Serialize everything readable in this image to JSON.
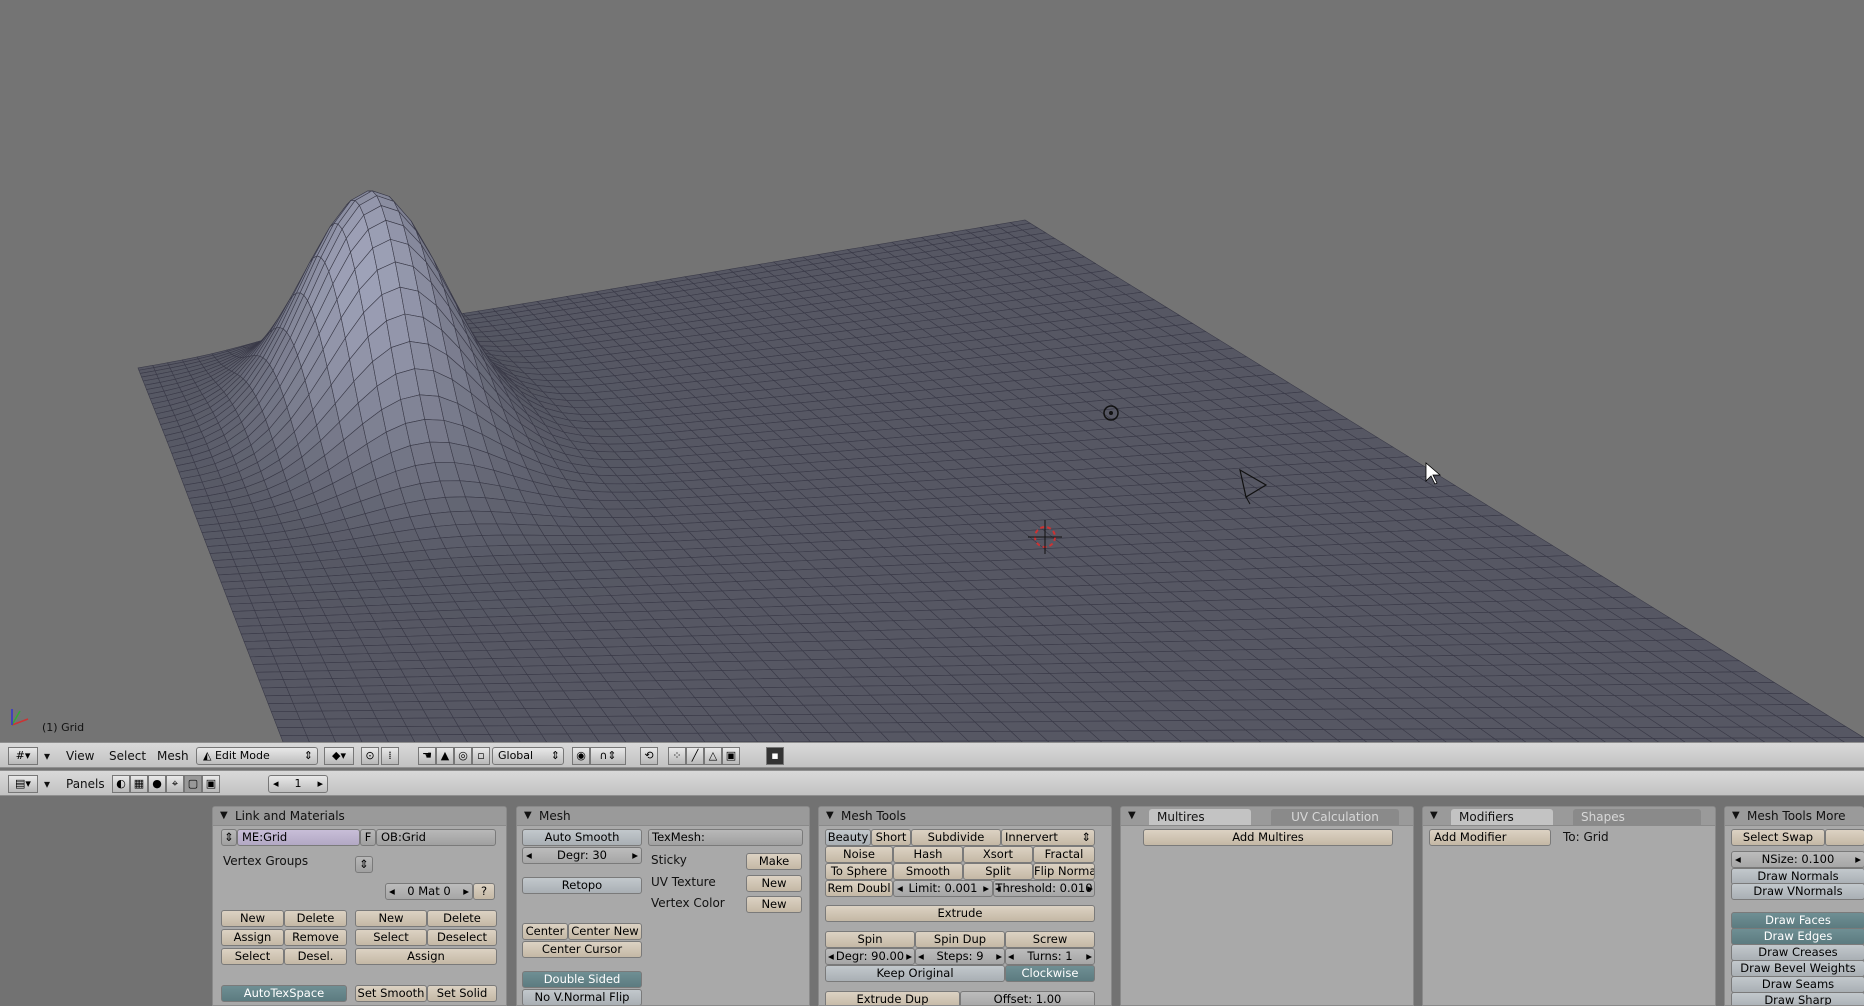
{
  "viewport": {
    "object_label": "(1) Grid"
  },
  "header3d": {
    "menus": [
      "View",
      "Select",
      "Mesh"
    ],
    "mode": "Edit Mode",
    "orientation": "Global"
  },
  "header_buttons": {
    "panels_label": "Panels",
    "frame": "1"
  },
  "link_materials": {
    "title": "Link and Materials",
    "me_field": "ME:Grid",
    "f_label": "F",
    "ob_field": "OB:Grid",
    "vertex_groups": "Vertex Groups",
    "mat_field": "0 Mat 0",
    "help": "?",
    "vg_new": "New",
    "vg_delete": "Delete",
    "vg_assign": "Assign",
    "vg_remove": "Remove",
    "vg_select": "Select",
    "vg_desel": "Desel.",
    "mat_new": "New",
    "mat_delete": "Delete",
    "mat_select": "Select",
    "mat_deselect": "Deselect",
    "mat_assign": "Assign",
    "autotexspace": "AutoTexSpace",
    "set_smooth": "Set Smooth",
    "set_solid": "Set Solid"
  },
  "mesh": {
    "title": "Mesh",
    "auto_smooth": "Auto Smooth",
    "degr": "Degr: 30",
    "retopo": "Retopo",
    "center": "Center",
    "center_new": "Center New",
    "center_cursor": "Center Cursor",
    "double_sided": "Double Sided",
    "no_v_normal_flip": "No V.Normal Flip",
    "texmesh": "TexMesh:",
    "sticky": "Sticky",
    "make": "Make",
    "uv_texture": "UV Texture",
    "uv_new": "New",
    "vertex_color": "Vertex Color",
    "vc_new": "New"
  },
  "mesh_tools": {
    "title": "Mesh Tools",
    "beauty": "Beauty",
    "short": "Short",
    "subdivide": "Subdivide",
    "innervert": "Innervert",
    "noise": "Noise",
    "hash": "Hash",
    "xsort": "Xsort",
    "fractal": "Fractal",
    "to_sphere": "To Sphere",
    "smooth": "Smooth",
    "split": "Split",
    "flip_normals": "Flip Normals",
    "rem_doubl": "Rem Doubl",
    "limit": "Limit: 0.001",
    "threshold": "Threshold: 0.010",
    "extrude": "Extrude",
    "spin": "Spin",
    "spin_dup": "Spin Dup",
    "screw": "Screw",
    "degr": "Degr: 90.00",
    "steps": "Steps: 9",
    "turns": "Turns: 1",
    "keep_original": "Keep Original",
    "clockwise": "Clockwise",
    "extrude_dup": "Extrude Dup",
    "offset": "Offset: 1.00"
  },
  "multires": {
    "tab1": "Multires",
    "tab2": "UV Calculation",
    "add_multires": "Add Multires"
  },
  "modifiers": {
    "tab1": "Modifiers",
    "tab2": "Shapes",
    "add_modifier": "Add Modifier",
    "to": "To: Grid"
  },
  "mesh_tools_more": {
    "title": "Mesh Tools More",
    "select_swap": "Select Swap",
    "nsize": "NSize: 0.100",
    "draw_normals": "Draw Normals",
    "draw_vnormals": "Draw VNormals",
    "draw_faces": "Draw Faces",
    "draw_edges": "Draw Edges",
    "draw_creases": "Draw Creases",
    "draw_bevel_weights": "Draw Bevel Weights",
    "draw_seams": "Draw Seams",
    "draw_sharp": "Draw Sharp"
  }
}
